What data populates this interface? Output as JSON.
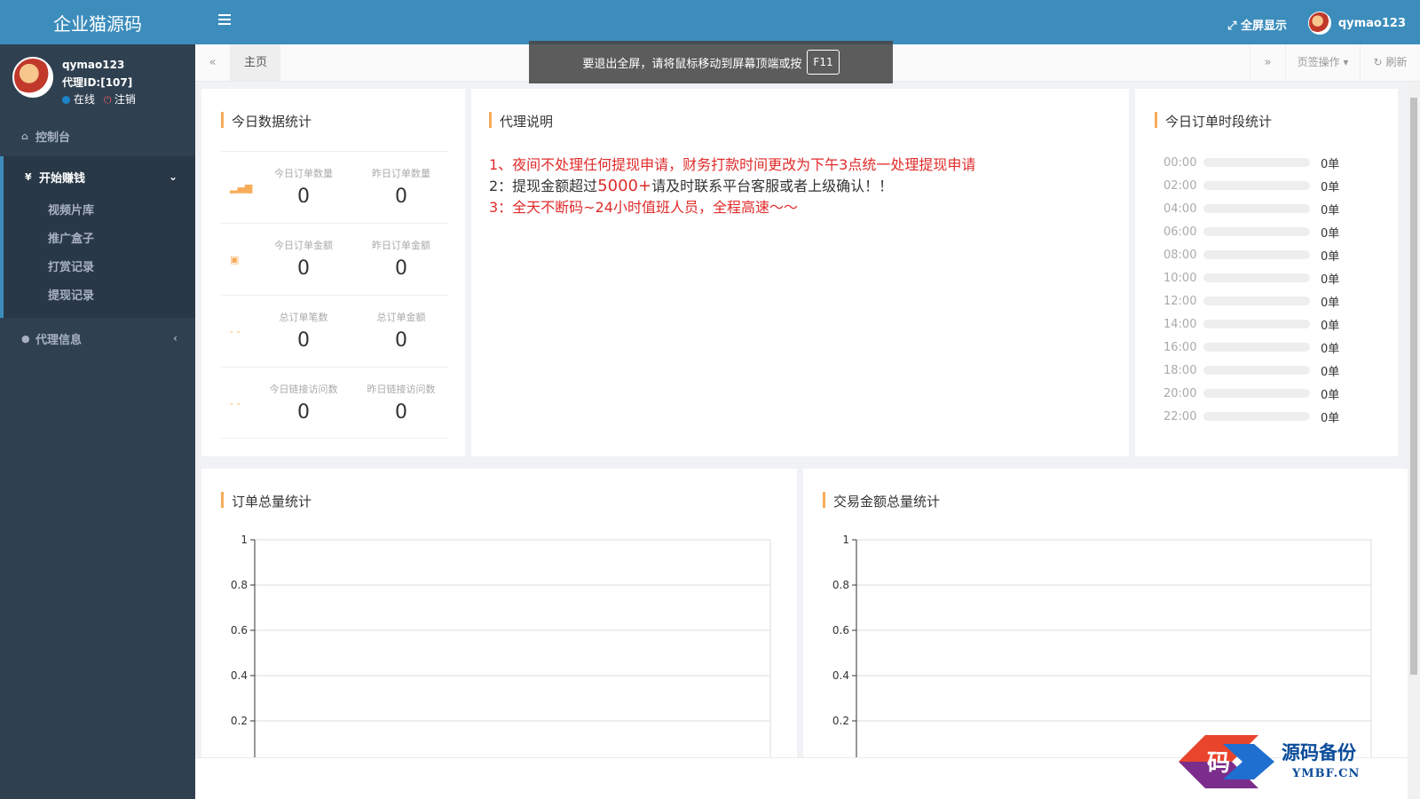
{
  "brand": "企业猫源码",
  "user": {
    "name": "qymao123",
    "agent_id": "代理ID:[107]",
    "status_online": "在线",
    "status_logout": "注销"
  },
  "sidebar": {
    "dashboard": "控制台",
    "earn_group": "开始赚钱",
    "currency_icon": "¥",
    "sub_items": [
      "视频片库",
      "推广盒子",
      "打赏记录",
      "提现记录"
    ],
    "agent_info": "代理信息"
  },
  "topbar": {
    "fullscreen": "全屏显示",
    "username": "qymao123"
  },
  "tabs": {
    "home": "主页",
    "ops": "页签操作",
    "refresh": "刷新"
  },
  "toast": {
    "text": "要退出全屏，请将鼠标移动到屏幕顶端或按",
    "key": "F11"
  },
  "today_stats": {
    "title": "今日数据统计",
    "rows": [
      {
        "icon": "bar-chart-icon",
        "a_label": "今日订单数量",
        "a_value": "0",
        "b_label": "昨日订单数量",
        "b_value": "0"
      },
      {
        "icon": "box-icon",
        "a_label": "今日订单金额",
        "a_value": "0",
        "b_label": "昨日订单金额",
        "b_value": "0"
      },
      {
        "icon": "dash-icon",
        "a_label": "总订单笔数",
        "a_value": "0",
        "b_label": "总订单金额",
        "b_value": "0"
      },
      {
        "icon": "dash-icon",
        "a_label": "今日链接访问数",
        "a_value": "0",
        "b_label": "昨日链接访问数",
        "b_value": "0"
      }
    ]
  },
  "agent_notes": {
    "title": "代理说明",
    "line1": "1、夜间不处理任何提现申请，财务打款时间更改为下午3点统一处理提现申请",
    "line2_prefix": "2：提现金额超过",
    "line2_highlight": "5000+",
    "line2_suffix": "请及时联系平台客服或者上级确认！！",
    "line3": "3：全天不断码~24小时值班人员，全程高速～～",
    "red": "#e02b2b"
  },
  "timeslots": {
    "title": "今日订单时段统计",
    "rows": [
      {
        "time": "00:00",
        "value": "0单",
        "ratio": 0
      },
      {
        "time": "02:00",
        "value": "0单",
        "ratio": 0
      },
      {
        "time": "04:00",
        "value": "0单",
        "ratio": 0
      },
      {
        "time": "06:00",
        "value": "0单",
        "ratio": 0
      },
      {
        "time": "08:00",
        "value": "0单",
        "ratio": 0
      },
      {
        "time": "10:00",
        "value": "0单",
        "ratio": 0
      },
      {
        "time": "12:00",
        "value": "0单",
        "ratio": 0
      },
      {
        "time": "14:00",
        "value": "0单",
        "ratio": 0
      },
      {
        "time": "16:00",
        "value": "0单",
        "ratio": 0
      },
      {
        "time": "18:00",
        "value": "0单",
        "ratio": 0
      },
      {
        "time": "20:00",
        "value": "0单",
        "ratio": 0
      },
      {
        "time": "22:00",
        "value": "0单",
        "ratio": 0
      }
    ]
  },
  "charts_titles": {
    "orders": "订单总量统计",
    "amount": "交易金额总量统计"
  },
  "chart_data": [
    {
      "type": "line",
      "title": "",
      "x": [],
      "series": [],
      "ylim": [
        0,
        1
      ],
      "yticks": [
        1,
        0.8,
        0.6,
        0.4,
        0.2
      ],
      "grid": true
    },
    {
      "type": "line",
      "title": "",
      "x": [],
      "series": [],
      "ylim": [
        0,
        1
      ],
      "yticks": [
        1,
        0.8,
        0.6,
        0.4,
        0.2
      ],
      "grid": true
    }
  ],
  "watermark": {
    "main": "源码备份",
    "sub": "YMBF.CN"
  },
  "colors": {
    "accent": "#3c8dbc",
    "sidebar": "#2f4050",
    "orange": "#f8ac59"
  }
}
